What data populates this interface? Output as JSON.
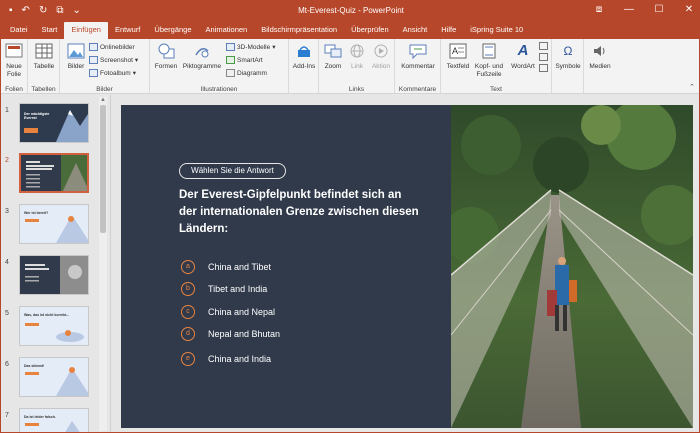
{
  "window": {
    "title": "Mt-Everest-Quiz - PowerPoint",
    "qat": [
      "save-icon",
      "undo-icon",
      "redo-icon",
      "present-icon",
      "customize-icon"
    ]
  },
  "tabs": [
    {
      "label": "Datei"
    },
    {
      "label": "Start"
    },
    {
      "label": "Einfügen",
      "active": true
    },
    {
      "label": "Entwurf"
    },
    {
      "label": "Übergänge"
    },
    {
      "label": "Animationen"
    },
    {
      "label": "Bildschirmpräsentation"
    },
    {
      "label": "Überprüfen"
    },
    {
      "label": "Ansicht"
    },
    {
      "label": "Hilfe"
    },
    {
      "label": "iSpring Suite 10"
    }
  ],
  "ribbon": {
    "folien": {
      "label": "Folien",
      "neue_folie": "Neue Folie"
    },
    "tabellen": {
      "label": "Tabellen",
      "tabelle": "Tabelle"
    },
    "bilder": {
      "label": "Bilder",
      "bilder": "Bilder",
      "onlinebilder": "Onlinebilder",
      "screenshot": "Screenshot",
      "fotoalbum": "Fotoalbum"
    },
    "illustrationen": {
      "label": "Illustrationen",
      "formen": "Formen",
      "piktogramme": "Piktogramme",
      "modelle": "3D-Modelle",
      "smartart": "SmartArt",
      "diagramm": "Diagramm"
    },
    "addins": {
      "label": "Add-Ins",
      "addins": "Add-Ins"
    },
    "links": {
      "label": "Links",
      "zoom": "Zoom",
      "link": "Link",
      "aktion": "Aktion"
    },
    "kommentare": {
      "label": "Kommentare",
      "kommentar": "Kommentar"
    },
    "text": {
      "label": "Text",
      "textfeld": "Textfeld",
      "kopf": "Kopf- und Fußzeile",
      "wordart": "WordArt"
    },
    "symbole": {
      "label": "Symbole"
    },
    "medien": {
      "label": "Medien"
    }
  },
  "thumbnails": [
    {
      "num": "1",
      "title": "Der mächtigste Everest"
    },
    {
      "num": "2",
      "active": true
    },
    {
      "num": "3",
      "title": "Wer ist bereit?"
    },
    {
      "num": "4",
      "title": ""
    },
    {
      "num": "5",
      "title": "Was, das ist nicht korrekt..."
    },
    {
      "num": "6",
      "title": "Das stimmt!"
    },
    {
      "num": "7",
      "title": "Da ist leider falsch."
    }
  ],
  "slide": {
    "pill": "Wählen Sie die Antwort",
    "question": "Der Everest-Gipfelpunkt befindet sich an der internationalen Grenze zwischen diesen Ländern:",
    "answers": [
      {
        "letter": "a",
        "text": "China and Tibet"
      },
      {
        "letter": "b",
        "text": "Tibet and India"
      },
      {
        "letter": "c",
        "text": "China and Nepal"
      },
      {
        "letter": "d",
        "text": "Nepal and Bhutan"
      },
      {
        "letter": "e",
        "text": "China and India"
      }
    ]
  },
  "colors": {
    "brand": "#b7472a",
    "accent": "#e8833f",
    "slide_bg": "#313a4b"
  }
}
